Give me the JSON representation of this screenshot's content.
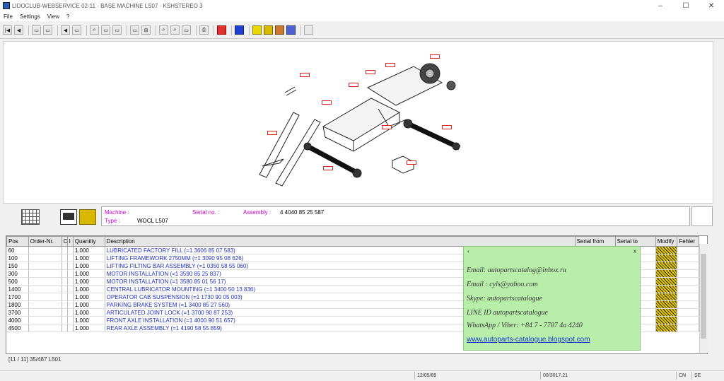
{
  "window": {
    "title": "LIDOCLUB-WEBSERVICE 02-11 · BASE MACHINE LS07 · KSHSTEREO 3",
    "minimize": "–",
    "maximize": "☐",
    "close": "✕"
  },
  "menu": [
    "File",
    "Settings",
    "View",
    "?"
  ],
  "toolbar": {
    "buttons": [
      "|◀",
      "◀",
      "▭",
      "▭",
      "◀",
      "▭",
      "⌕",
      "▭",
      "▭",
      "▭",
      "⊞",
      "⊞",
      "⌕",
      "⌕",
      "▭",
      "⎙",
      "■",
      "■",
      "■",
      "▭",
      "▭",
      "▭",
      "▭"
    ],
    "colors": {
      "red": "#e03030",
      "blue": "#2040d0",
      "yellow": "#e8d800"
    }
  },
  "info": {
    "machine_label": "Machine :",
    "serial_label": "Serial no. :",
    "assembly_label": "Assembly :",
    "assembly_value": "4 4040 85 25 587",
    "type_label": "Type :",
    "type_value": "WOCL L507"
  },
  "table": {
    "headers": [
      "Pos",
      "Order-Nr.",
      "C",
      "I",
      "Quantity",
      "Description",
      "Serial from",
      "Serial to",
      "Modify",
      "Fehler"
    ],
    "rows": [
      {
        "pos": "60",
        "qty": "1.000",
        "desc": "LUBRICATED FACTORY FILL (=1 3606 85 07 583)"
      },
      {
        "pos": "100",
        "qty": "1.000",
        "desc": "LIFTING FRAMEWORK 2750MM (=1 3090 95 08 626)"
      },
      {
        "pos": "150",
        "qty": "1.000",
        "desc": "LIFTING FILTING BAR ASSEMBLY (=1 0350 58 55 060)"
      },
      {
        "pos": "300",
        "qty": "1.000",
        "desc": "MOTOR INSTALLATION (=1 3590 85 25 837)"
      },
      {
        "pos": "500",
        "qty": "1.000",
        "desc": "MOTOR INSTALLATION (=1 3580 85 01 56 17)"
      },
      {
        "pos": "1400",
        "qty": "1.000",
        "desc": "CENTRAL LUBRICATOR MOUNTING (=1 3400 50 13 836)"
      },
      {
        "pos": "1700",
        "qty": "1.000",
        "desc": "OPERATOR CAB SUSPENSION (=1 1730 90 05 003)"
      },
      {
        "pos": "1800",
        "qty": "1.000",
        "desc": "PARKING BRAKE SYSTEM (=1 3400 85 27 560)"
      },
      {
        "pos": "3700",
        "qty": "1.000",
        "desc": "ARTICULATED JOINT LOCK (=1 3700 90 87 253)"
      },
      {
        "pos": "4000",
        "qty": "1.000",
        "desc": "FRONT AXLE INSTALLATION (=1 4000 90 51 657)"
      },
      {
        "pos": "4500",
        "qty": "1.000",
        "desc": "REAR AXLE ASSEMBLY (=1 4190 58 55 859)"
      }
    ]
  },
  "popup": {
    "back": "‹",
    "close": "x",
    "email1": "Email: autopartscatalog@inbox.ru",
    "email2": "Email : cyls@yahoo.com",
    "skype": "Skype: autopartscatalogue",
    "line": "LINE ID autopartscatalogue",
    "whatsapp": "WhatsApp / Viber: +84 7 - 7707 4a 4240",
    "link": "www.autoparts-catalogue.blogspot.com"
  },
  "count_text": "[11 / 11] 35/487 L501",
  "status": {
    "cell1": "12/05/89",
    "cell2": "00/3017.21",
    "cell3": "CN",
    "cell4": "SE"
  }
}
